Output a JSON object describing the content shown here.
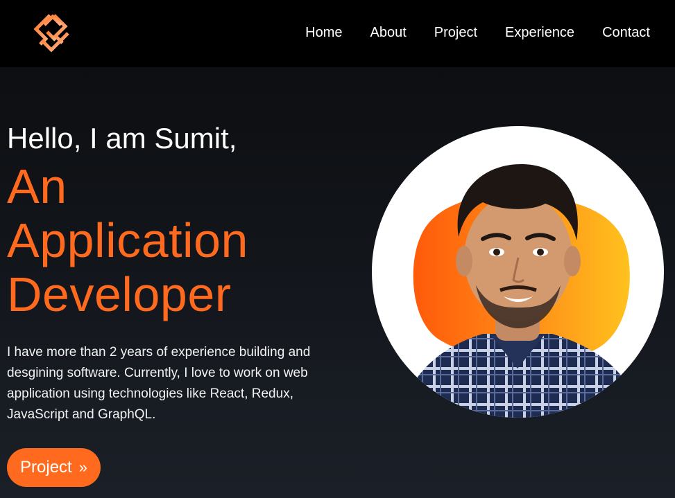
{
  "nav": {
    "logo_icon": "s-monogram-logo",
    "links": [
      "Home",
      "About",
      "Project",
      "Experience",
      "Contact"
    ]
  },
  "hero": {
    "greeting": "Hello, I am Sumit,",
    "role_lines": [
      "An",
      "Application",
      "Developer"
    ],
    "bio": "I have more than 2 years of experience building and desgining software. Currently, I love to work on web application using technologies like React, Redux, JavaScript and GraphQL.",
    "cta_label": "Project",
    "cta_icon": "double-chevron-right-icon"
  },
  "colors": {
    "accent": "#ff6a1e",
    "nav_bg": "#000000",
    "page_bg_top": "#0b0c0e",
    "page_bg_bottom": "#1b2028",
    "blob_left": "#ff5a0a",
    "blob_right": "#ffc21e"
  }
}
